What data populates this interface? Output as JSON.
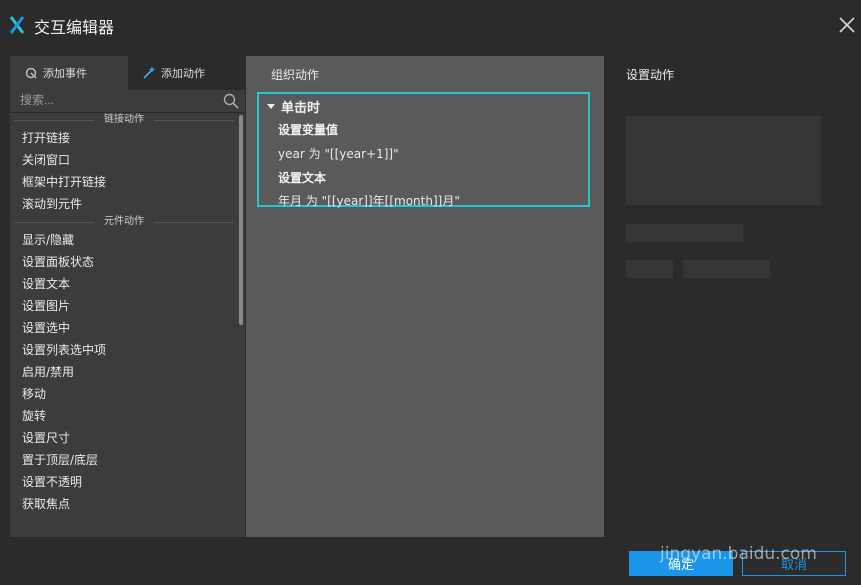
{
  "window": {
    "title": "交互编辑器"
  },
  "tabs": {
    "events": "添加事件",
    "actions": "添加动作"
  },
  "search": {
    "placeholder": "搜索..."
  },
  "sections": [
    {
      "header": "链接动作",
      "items": [
        "打开链接",
        "关闭窗口",
        "框架中打开链接",
        "滚动到元件"
      ]
    },
    {
      "header": "元件动作",
      "items": [
        "显示/隐藏",
        "设置面板状态",
        "设置文本",
        "设置图片",
        "设置选中",
        "设置列表选中项",
        "启用/禁用",
        "移动",
        "旋转",
        "设置尺寸",
        "置于顶层/底层",
        "设置不透明",
        "获取焦点"
      ]
    }
  ],
  "middle": {
    "title": "组织动作",
    "case": {
      "name": "单击时",
      "actions": [
        {
          "name": "设置变量值",
          "detail": "year 为 \"[[year+1]]\""
        },
        {
          "name": "设置文本",
          "detail": "年月 为 \"[[year]]年[[month]]月\""
        }
      ]
    }
  },
  "right": {
    "title": "设置动作"
  },
  "footer": {
    "ok": "确定",
    "cancel": "取消"
  },
  "watermark": "jingyan.baidu.com",
  "colors": {
    "accent": "#1a95e8",
    "highlight": "#1fc8d4"
  }
}
